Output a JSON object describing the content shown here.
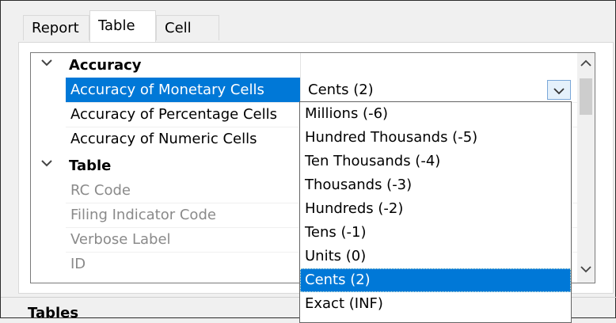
{
  "tabs": [
    {
      "label": "Report"
    },
    {
      "label": "Table"
    },
    {
      "label": "Cell"
    }
  ],
  "active_tab": "Table",
  "categories": [
    {
      "label": "Accuracy",
      "expanded": true,
      "properties": [
        {
          "name": "Accuracy of Monetary Cells",
          "value": "Cents (2)"
        },
        {
          "name": "Accuracy of Percentage Cells",
          "value": ""
        },
        {
          "name": "Accuracy of Numeric Cells",
          "value": ""
        }
      ]
    },
    {
      "label": "Table",
      "expanded": true,
      "properties": [
        {
          "name": "RC Code",
          "value": ""
        },
        {
          "name": "Filing Indicator Code",
          "value": ""
        },
        {
          "name": "Verbose Label",
          "value": ""
        },
        {
          "name": "ID",
          "value": ""
        }
      ]
    }
  ],
  "dropdown": {
    "options": [
      "Millions (-6)",
      "Hundred Thousands (-5)",
      "Ten Thousands (-4)",
      "Thousands (-3)",
      "Hundreds (-2)",
      "Tens (-1)",
      "Units (0)",
      "Cents (2)",
      "Exact (INF)"
    ],
    "selected": "Cents (2)"
  },
  "footer": {
    "label": "Tables"
  },
  "colors": {
    "selection": "#0078d7",
    "disabled_text": "#8a8a8a"
  },
  "icons": {
    "collapse": "chevron-down-icon",
    "dropdown": "chevron-down-icon",
    "scroll_up": "chevron-up-icon",
    "scroll_down": "chevron-down-icon"
  }
}
